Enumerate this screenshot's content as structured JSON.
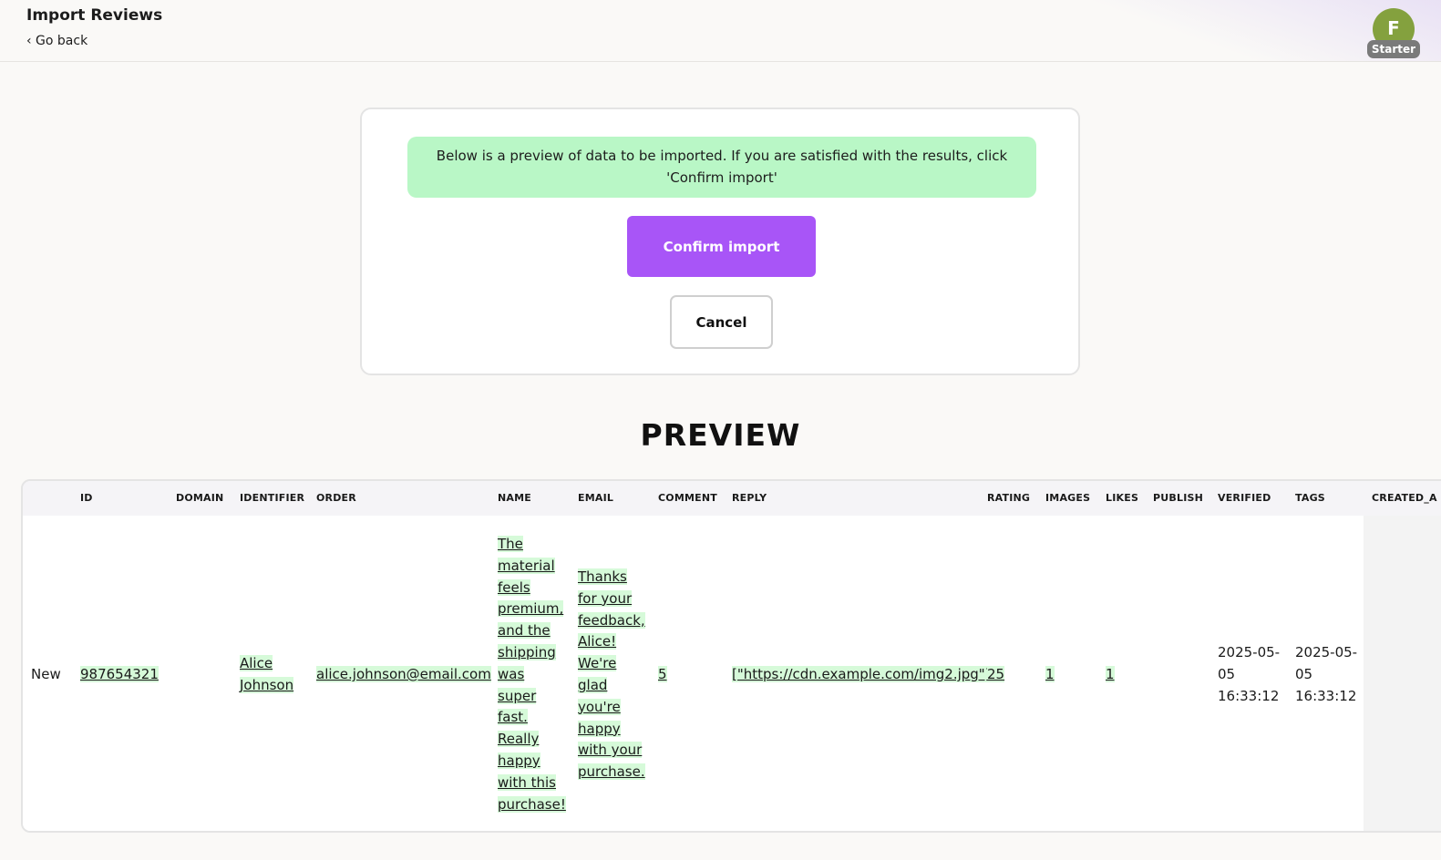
{
  "header": {
    "title": "Import Reviews",
    "back_label": "‹ Go back",
    "avatar_initial": "F",
    "plan_badge": "Starter"
  },
  "import_card": {
    "notice": "Below is a preview of data to be imported. If you are satisfied with the results, click 'Confirm import'",
    "confirm_label": "Confirm import",
    "cancel_label": "Cancel"
  },
  "preview": {
    "heading": "PREVIEW",
    "columns": [
      "ID",
      "DOMAIN",
      "IDENTIFIER",
      "ORDER",
      "NAME",
      "EMAIL",
      "COMMENT",
      "REPLY",
      "RATING",
      "IMAGES",
      "LIKES",
      "PUBLISH",
      "VERIFIED",
      "TAGS",
      "CREATED_A"
    ],
    "rows": [
      {
        "status": "New",
        "id": "987654321",
        "identifier": "Alice Johnson",
        "order": "alice.johnson@email.com",
        "name": "The material feels premium, and the shipping was super fast. Really happy with this purchase!",
        "email": "Thanks for your feedback, Alice! We're glad you're happy with your purchase.",
        "comment": "5",
        "reply": "[\"https://cdn.example.com/img2.jpg\"]",
        "rating": "25",
        "images": "1",
        "likes": "1",
        "verified": "2025-05-05 16:33:12",
        "tags": "2025-05-05 16:33:12"
      }
    ]
  },
  "colors": {
    "accent": "#a855f7",
    "notice_bg": "#b9f7c6",
    "highlight_bg": "#d6fad9",
    "avatar": "#84a13e"
  }
}
